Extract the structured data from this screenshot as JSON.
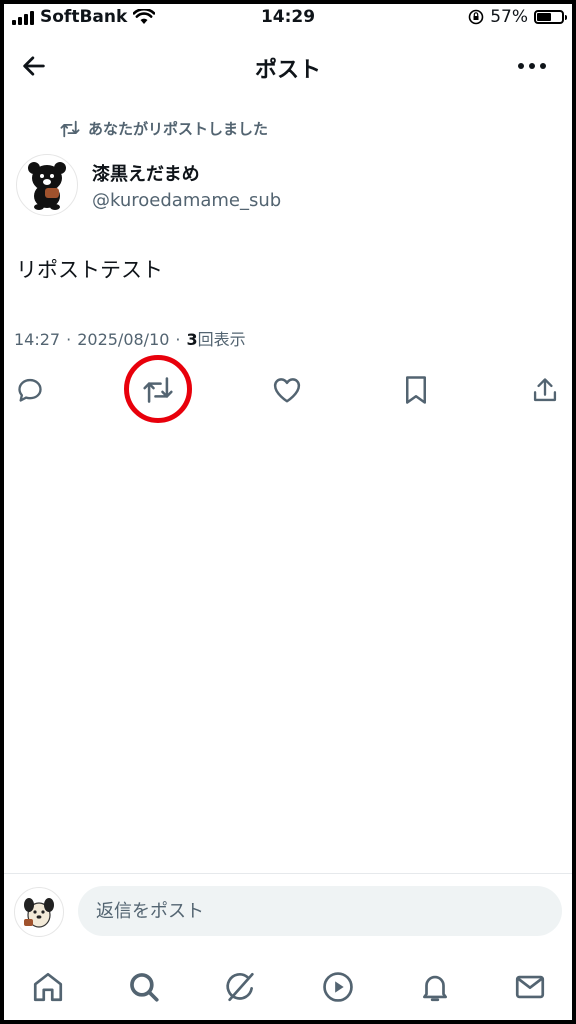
{
  "status_bar": {
    "carrier": "SoftBank",
    "time": "14:29",
    "battery": "57%",
    "battery_level": 0.57
  },
  "header": {
    "title": "ポスト"
  },
  "post": {
    "repost_note": "あなたがリポストしました",
    "display_name": "漆黒えだまめ",
    "handle": "@kuroedamame_sub",
    "text": "リポストテスト",
    "time": "14:27",
    "date": "2025/08/10",
    "views_count": "3",
    "views_label": "回表示"
  },
  "reply": {
    "placeholder": "返信をポスト"
  },
  "colors": {
    "accent_highlight": "#e8000b",
    "secondary_text": "#536471",
    "primary_text": "#0f1419"
  },
  "tabs": [
    "home-icon",
    "search-icon",
    "grok-icon",
    "video-icon",
    "notifications-icon",
    "messages-icon"
  ]
}
